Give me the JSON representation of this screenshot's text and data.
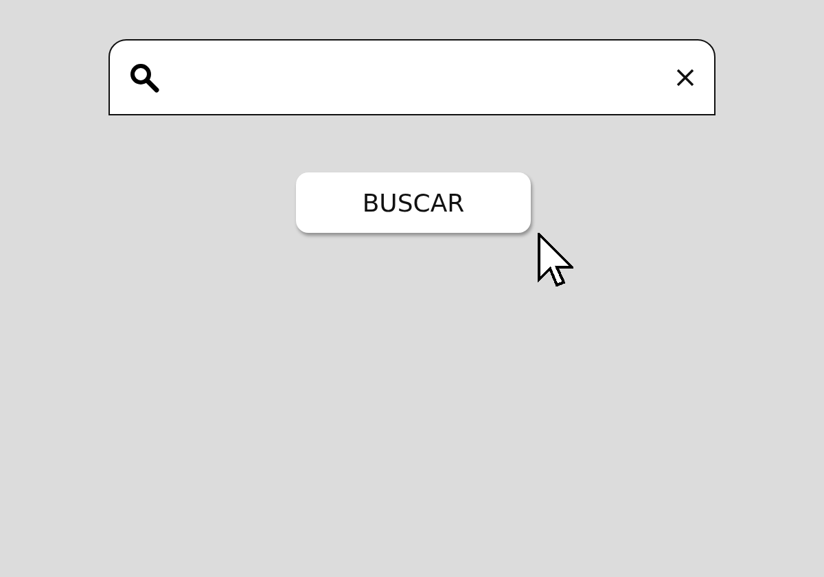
{
  "search_button": {
    "label": "BUSCAR"
  }
}
